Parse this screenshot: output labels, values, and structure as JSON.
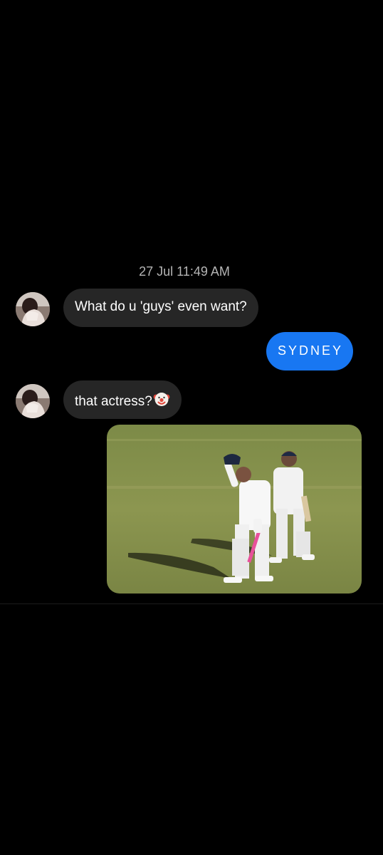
{
  "chat": {
    "timestamp": "27 Jul 11:49 AM",
    "messages": [
      {
        "direction": "incoming",
        "text": "What do u 'guys' even want?"
      },
      {
        "direction": "outgoing",
        "text": "SYDNEY"
      },
      {
        "direction": "incoming",
        "text": "that actress?",
        "emoji": "clown-face"
      },
      {
        "direction": "outgoing",
        "type": "image",
        "image_subject": "cricket-players-photo"
      }
    ]
  },
  "colors": {
    "background": "#000000",
    "incoming_bubble": "#262626",
    "outgoing_bubble": "#1877f2",
    "timestamp_text": "#b5b5b5"
  }
}
